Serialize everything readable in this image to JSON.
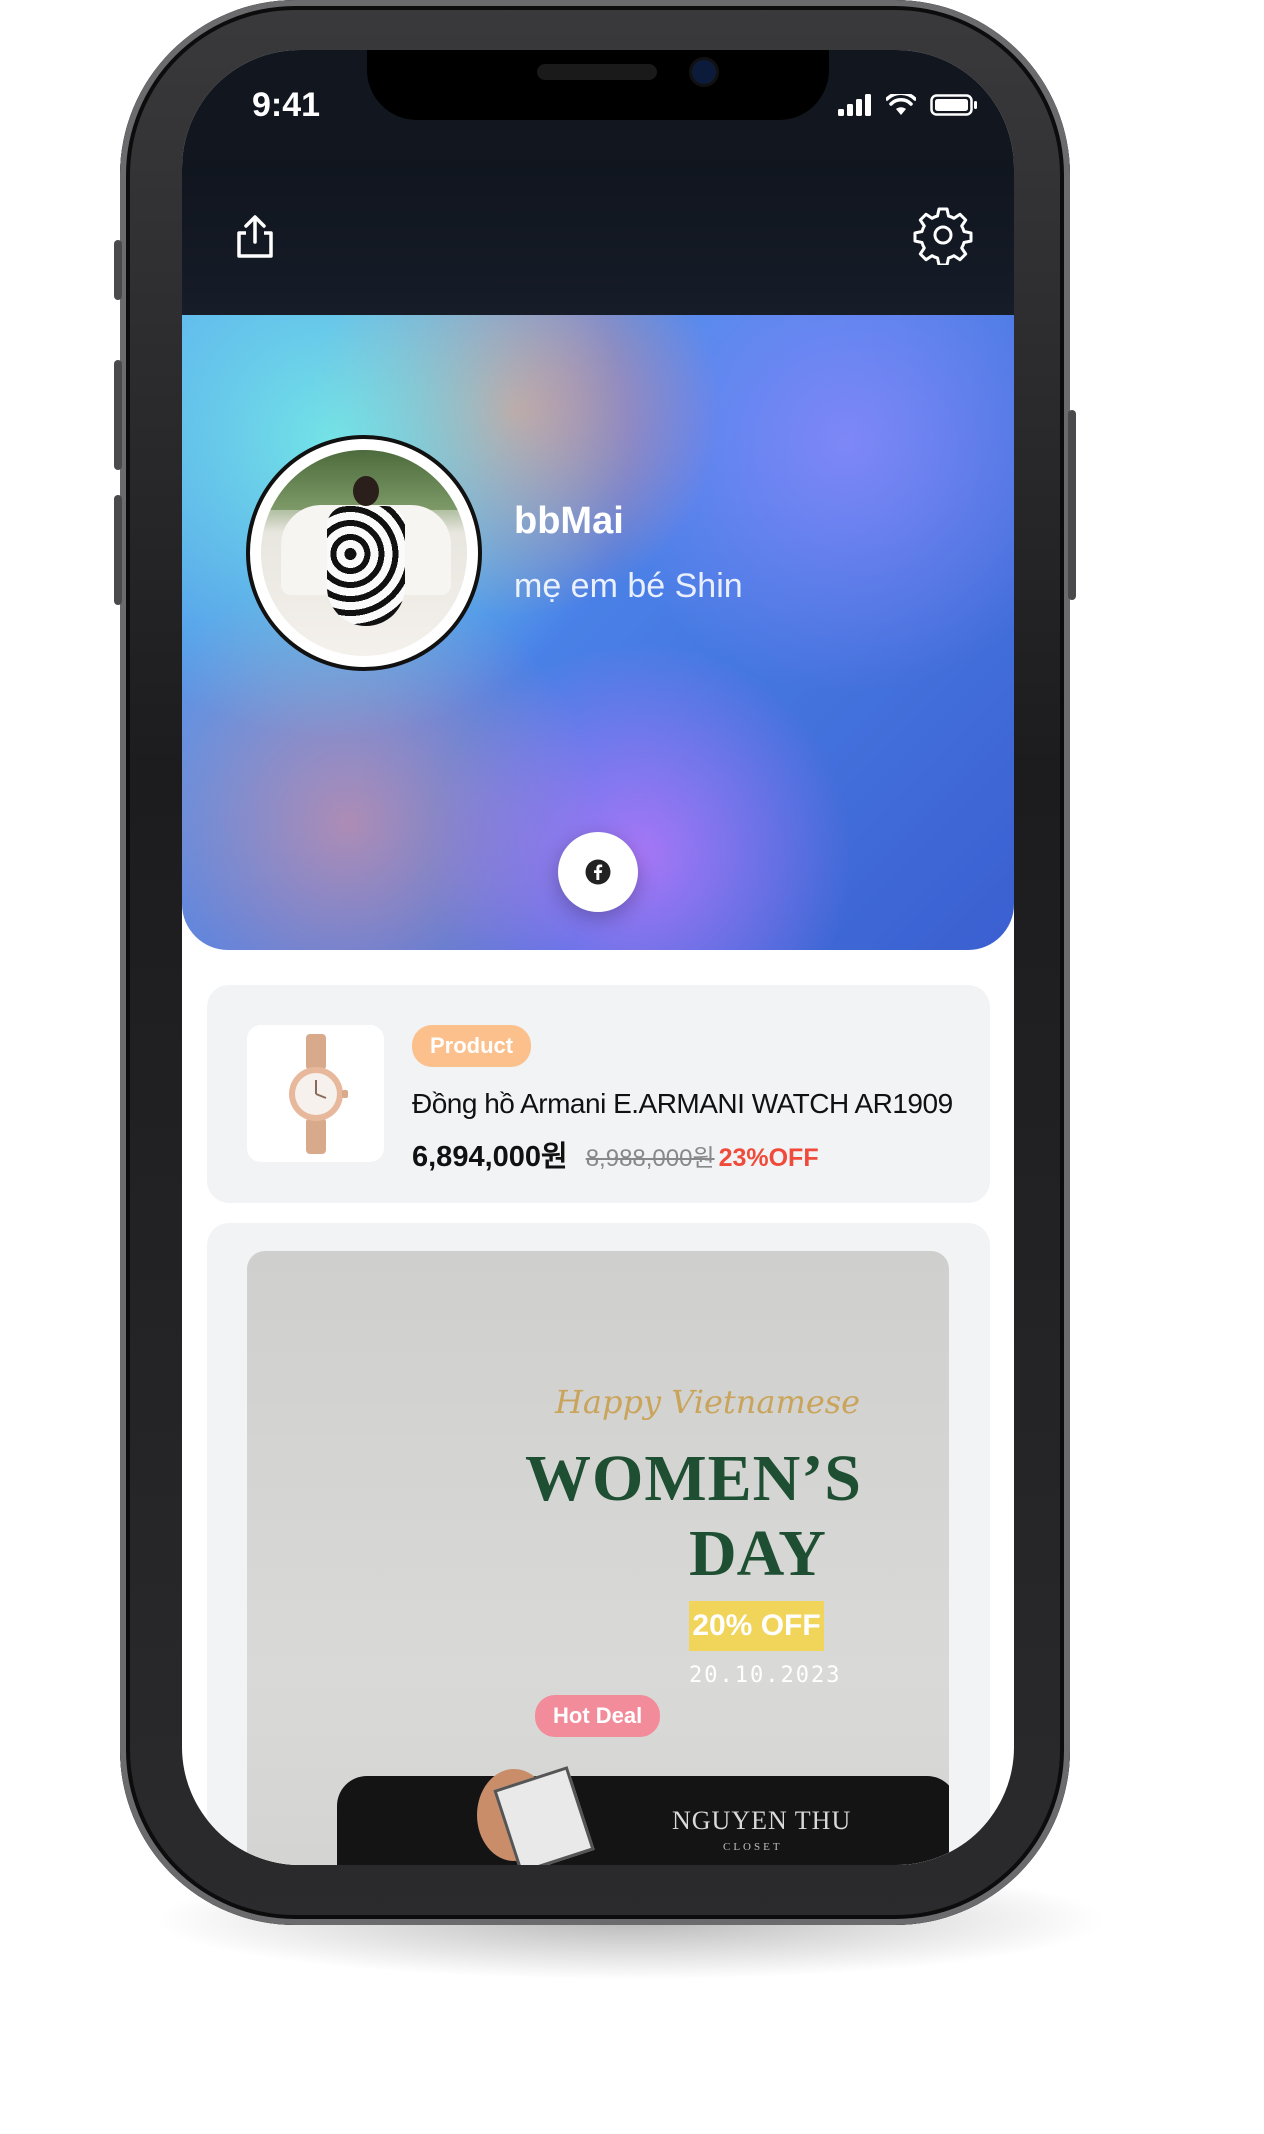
{
  "status_bar": {
    "time": "9:41"
  },
  "toolbar": {
    "share_icon": "share-icon",
    "settings_icon": "gear-icon"
  },
  "profile": {
    "name": "bbMai",
    "bio": "mẹ em bé Shin",
    "social": [
      "facebook-icon"
    ]
  },
  "product_card": {
    "badge": "Product",
    "title": "Đồng hồ Armani E.ARMANI WATCH AR1909",
    "price": "6,894,000원",
    "original_price": "8,988,000원",
    "discount": "23%OFF"
  },
  "deal_card": {
    "badge": "Hot Deal",
    "image_text": {
      "script": "Happy Vietnamese",
      "headline_1": "WOMEN’S",
      "headline_2": "DAY",
      "offer": "20% OFF",
      "date": "20.10.2023",
      "brand": "NGUYEN THU",
      "brand_sub": "CLOSET"
    }
  },
  "colors": {
    "discount_red": "#ef4a3a",
    "product_badge": "#fbc08c",
    "hot_deal_badge": "#f28b9a",
    "headline_green": "#1f4f32",
    "offer_yellow": "#f1d45a"
  }
}
